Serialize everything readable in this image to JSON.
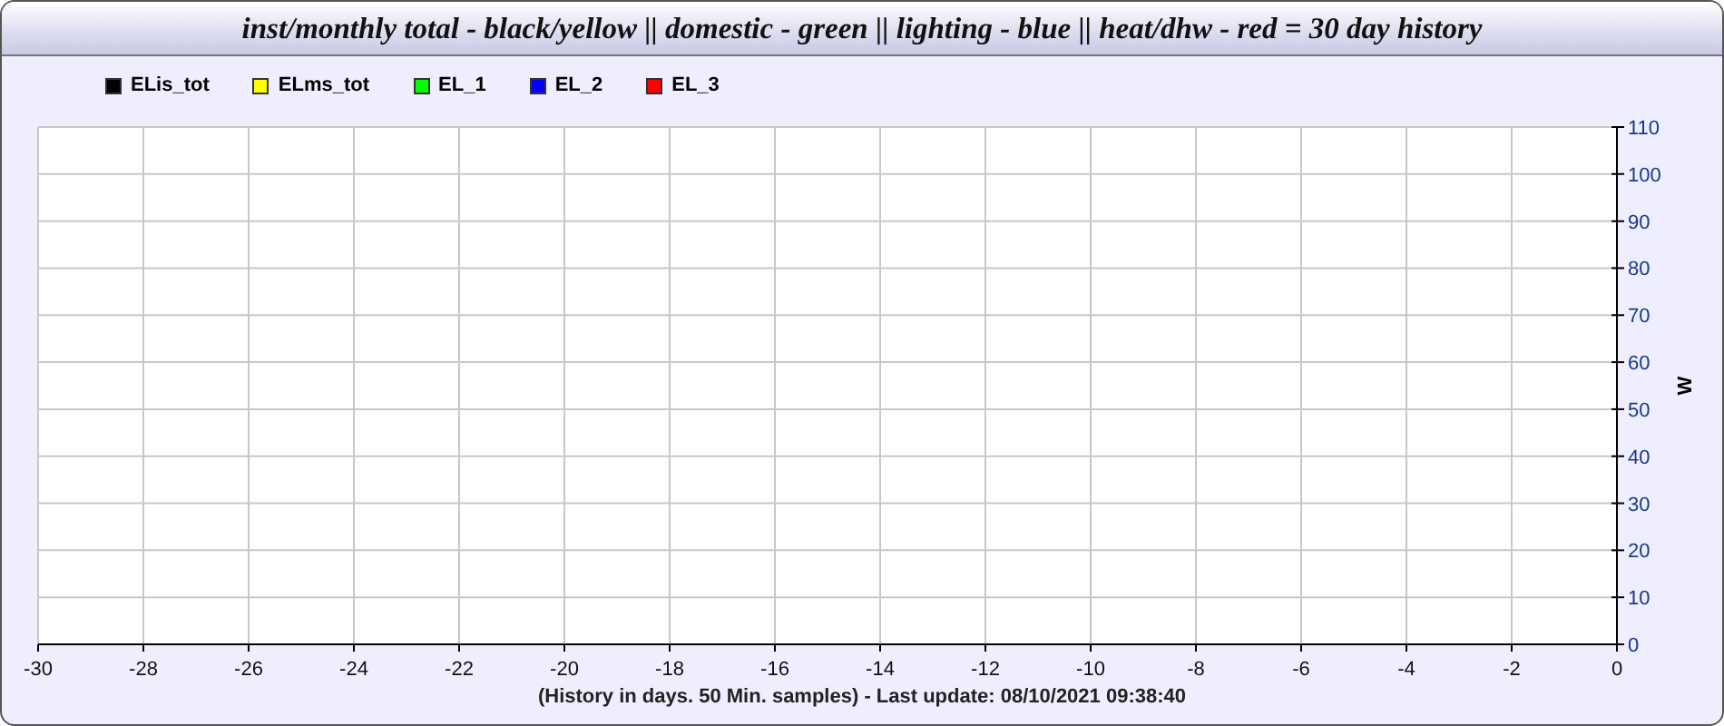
{
  "window": {
    "title": "inst/monthly total - black/yellow || domestic - green || lighting - blue || heat/dhw - red = 30 day history"
  },
  "chart": {
    "chart_data": {
      "type": "line",
      "ylabel": "W",
      "ylim": [
        0,
        110
      ],
      "grid": true,
      "series": [
        {
          "name": "ELis_tot",
          "color": "#000000",
          "values": [
            null,
            null,
            null,
            null,
            null,
            null,
            null,
            null,
            null,
            null,
            null,
            null,
            null,
            null,
            null,
            null
          ]
        },
        {
          "name": "ELms_tot",
          "color": "#ffff00",
          "values": [
            null,
            null,
            null,
            null,
            null,
            null,
            null,
            null,
            null,
            null,
            null,
            null,
            null,
            null,
            null,
            null
          ]
        },
        {
          "name": "EL_1",
          "color": "#00ff00",
          "values": [
            null,
            null,
            null,
            null,
            null,
            null,
            null,
            null,
            null,
            null,
            null,
            null,
            null,
            null,
            null,
            null
          ]
        },
        {
          "name": "EL_2",
          "color": "#0000ff",
          "values": [
            null,
            null,
            null,
            null,
            null,
            null,
            null,
            null,
            null,
            null,
            null,
            null,
            null,
            null,
            null,
            null
          ]
        },
        {
          "name": "EL_3",
          "color": "#ff0000",
          "values": [
            null,
            null,
            null,
            null,
            null,
            null,
            null,
            null,
            null,
            null,
            null,
            null,
            null,
            null,
            null,
            null
          ]
        }
      ],
      "categories": [
        "-30",
        "-28",
        "-26",
        "-24",
        "-22",
        "-20",
        "-18",
        "-16",
        "-14",
        "-12",
        "-10",
        "-8",
        "-6",
        "-4",
        "-2",
        "0"
      ],
      "yticks": [
        0,
        10,
        20,
        30,
        40,
        50,
        60,
        70,
        80,
        90,
        100,
        110
      ]
    },
    "footer": "(History in days. 50 Min. samples) - Last update: 08/10/2021 09:38:40"
  }
}
